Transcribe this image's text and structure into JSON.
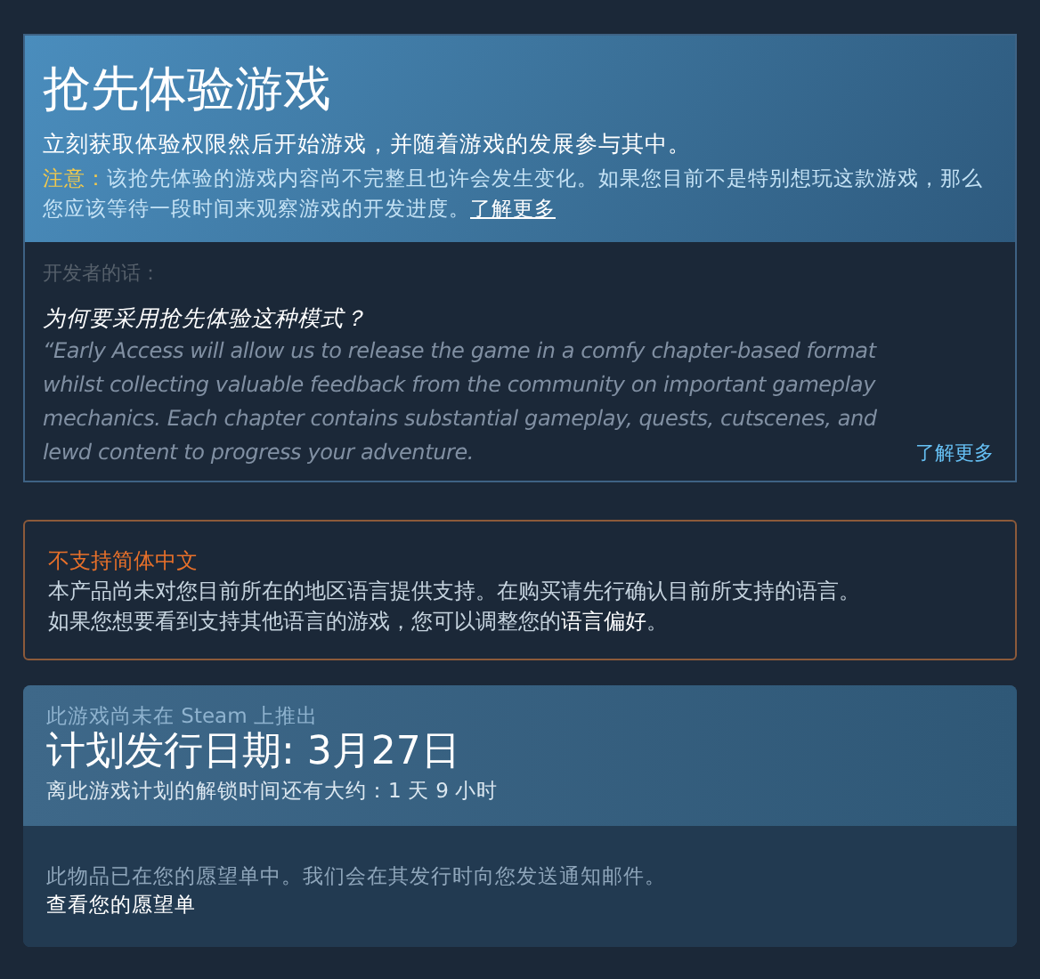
{
  "early_access": {
    "title": "抢先体验游戏",
    "subtitle": "立刻获取体验权限然后开始游戏，并随着游戏的发展参与其中。",
    "note_label": "注意：",
    "note_text": "该抢先体验的游戏内容尚不完整且也许会发生变化。如果您目前不是特别想玩这款游戏，那么您应该等待一段时间来观察游戏的开发进度。",
    "note_link": "了解更多",
    "developer_label": "开发者的话：",
    "question": "为何要采用抢先体验这种模式？",
    "answer": "“Early Access will allow us to release the game in a comfy chapter-based format whilst collecting valuable feedback from the community on important gameplay mechanics. Each chapter contains substantial gameplay, quests, cutscenes, and lewd content to progress your adventure.",
    "read_more": "了解更多"
  },
  "language_notice": {
    "title": "不支持简体中文",
    "line_1": "本产品尚未对您目前所在的地区语言提供支持。在购买请先行确认目前所支持的语言。",
    "line_2": "如果您想要看到支持其他语言的游戏，您可以调整您的",
    "link": "语言偏好",
    "line_2_end": "。"
  },
  "release": {
    "status": "此游戏尚未在 Steam 上推出",
    "date": "计划发行日期: 3月27日",
    "countdown": "离此游戏计划的解锁时间还有大约：1 天 9 小时",
    "wishlist_text": "此物品已在您的愿望单中。我们会在其发行时向您发送通知邮件。",
    "wishlist_link": "查看您的愿望单"
  }
}
